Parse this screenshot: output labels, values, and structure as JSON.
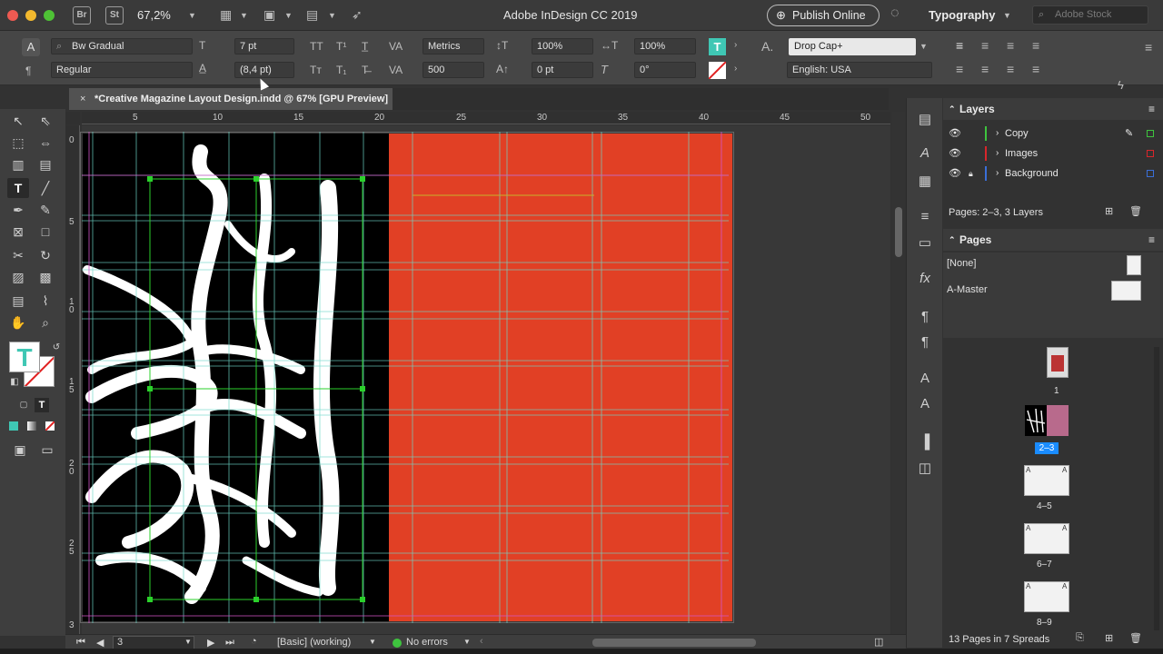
{
  "titlebar": {
    "app_title": "Adobe InDesign CC 2019",
    "zoom": "67,2%",
    "bridge_label": "Br",
    "stock_app_label": "St",
    "publish_label": "Publish Online",
    "workspace": "Typography",
    "stock_placeholder": "Adobe Stock"
  },
  "control": {
    "font_family": "Bw Gradual",
    "font_style": "Regular",
    "font_size": "7 pt",
    "leading": "(8,4 pt)",
    "kerning": "Metrics",
    "tracking": "500",
    "vertical_scale": "100%",
    "horizontal_scale": "100%",
    "baseline_shift": "0 pt",
    "skew": "0°",
    "paragraph_style": "Drop Cap+",
    "language": "English: USA"
  },
  "document": {
    "tab_title": "*Creative Magazine Layout Design.indd @ 67% [GPU Preview]"
  },
  "ruler": {
    "h_ticks": [
      "5",
      "10",
      "15",
      "20",
      "25",
      "30",
      "35",
      "40",
      "45",
      "50"
    ],
    "v_ticks": [
      "0",
      "5",
      "1\n0",
      "1\n5",
      "2\n0",
      "2\n5",
      "3"
    ]
  },
  "status": {
    "page": "3",
    "preflight_profile": "[Basic] (working)",
    "errors": "No errors"
  },
  "layers": {
    "title": "Layers",
    "items": [
      {
        "name": "Copy",
        "color": "#3ec43e"
      },
      {
        "name": "Images",
        "color": "#d8262b"
      },
      {
        "name": "Background",
        "color": "#3a6fd8"
      }
    ],
    "footer": "Pages: 2–3, 3 Layers"
  },
  "pages": {
    "title": "Pages",
    "masters": [
      "[None]",
      "A-Master"
    ],
    "spreads": [
      "1",
      "2–3",
      "4–5",
      "6–7",
      "8–9"
    ],
    "footer": "13 Pages in 7 Spreads"
  },
  "colors": {
    "accent": "#e14025",
    "selection": "#1a8cff",
    "frame_green": "#2bd12b"
  }
}
